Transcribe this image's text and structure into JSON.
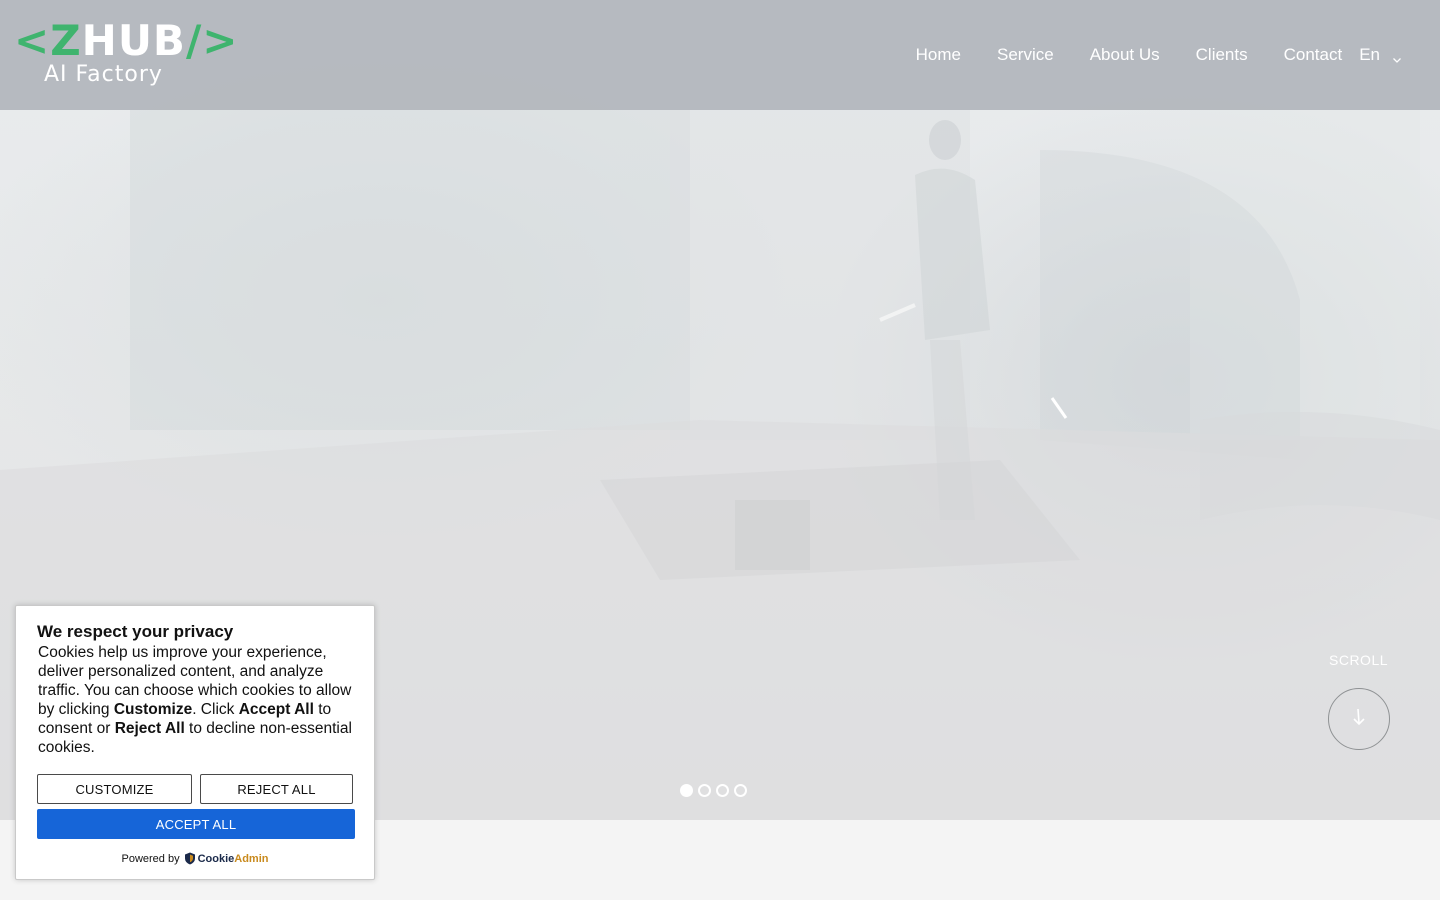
{
  "brand": {
    "logo_bracket_open": "<",
    "logo_z": "Z",
    "logo_hub": "HUB",
    "logo_bracket_close": "/>",
    "logo_sub": "AI Factory",
    "green": "#3fb46e"
  },
  "nav": {
    "items": [
      {
        "label": "Home"
      },
      {
        "label": "Service"
      },
      {
        "label": "About Us"
      },
      {
        "label": "Clients"
      },
      {
        "label": "Contact"
      }
    ],
    "language": "En",
    "language_icon": "chevron-down-icon"
  },
  "hero": {
    "scroll_label": "SCROLL",
    "scroll_icon": "arrow-down-icon",
    "slides": [
      {
        "active": true
      },
      {
        "active": false
      },
      {
        "active": false
      },
      {
        "active": false
      }
    ]
  },
  "cookie": {
    "title": "We respect your privacy",
    "text_1": "Cookies help us improve your experience, deliver personalized content, and analyze traffic. You can choose which cookies to allow by clicking ",
    "bold_customize": "Customize",
    "text_2": ". Click ",
    "bold_accept": "Accept All",
    "text_3": " to consent or ",
    "bold_reject": "Reject All",
    "text_4": " to decline non-essential cookies.",
    "customize_label": "CUSTOMIZE",
    "reject_label": "REJECT ALL",
    "accept_label": "ACCEPT ALL",
    "powered_by": "Powered by",
    "powered_brand_1": "Cookie",
    "powered_brand_2": "Admin",
    "primary_color": "#1665d8"
  }
}
